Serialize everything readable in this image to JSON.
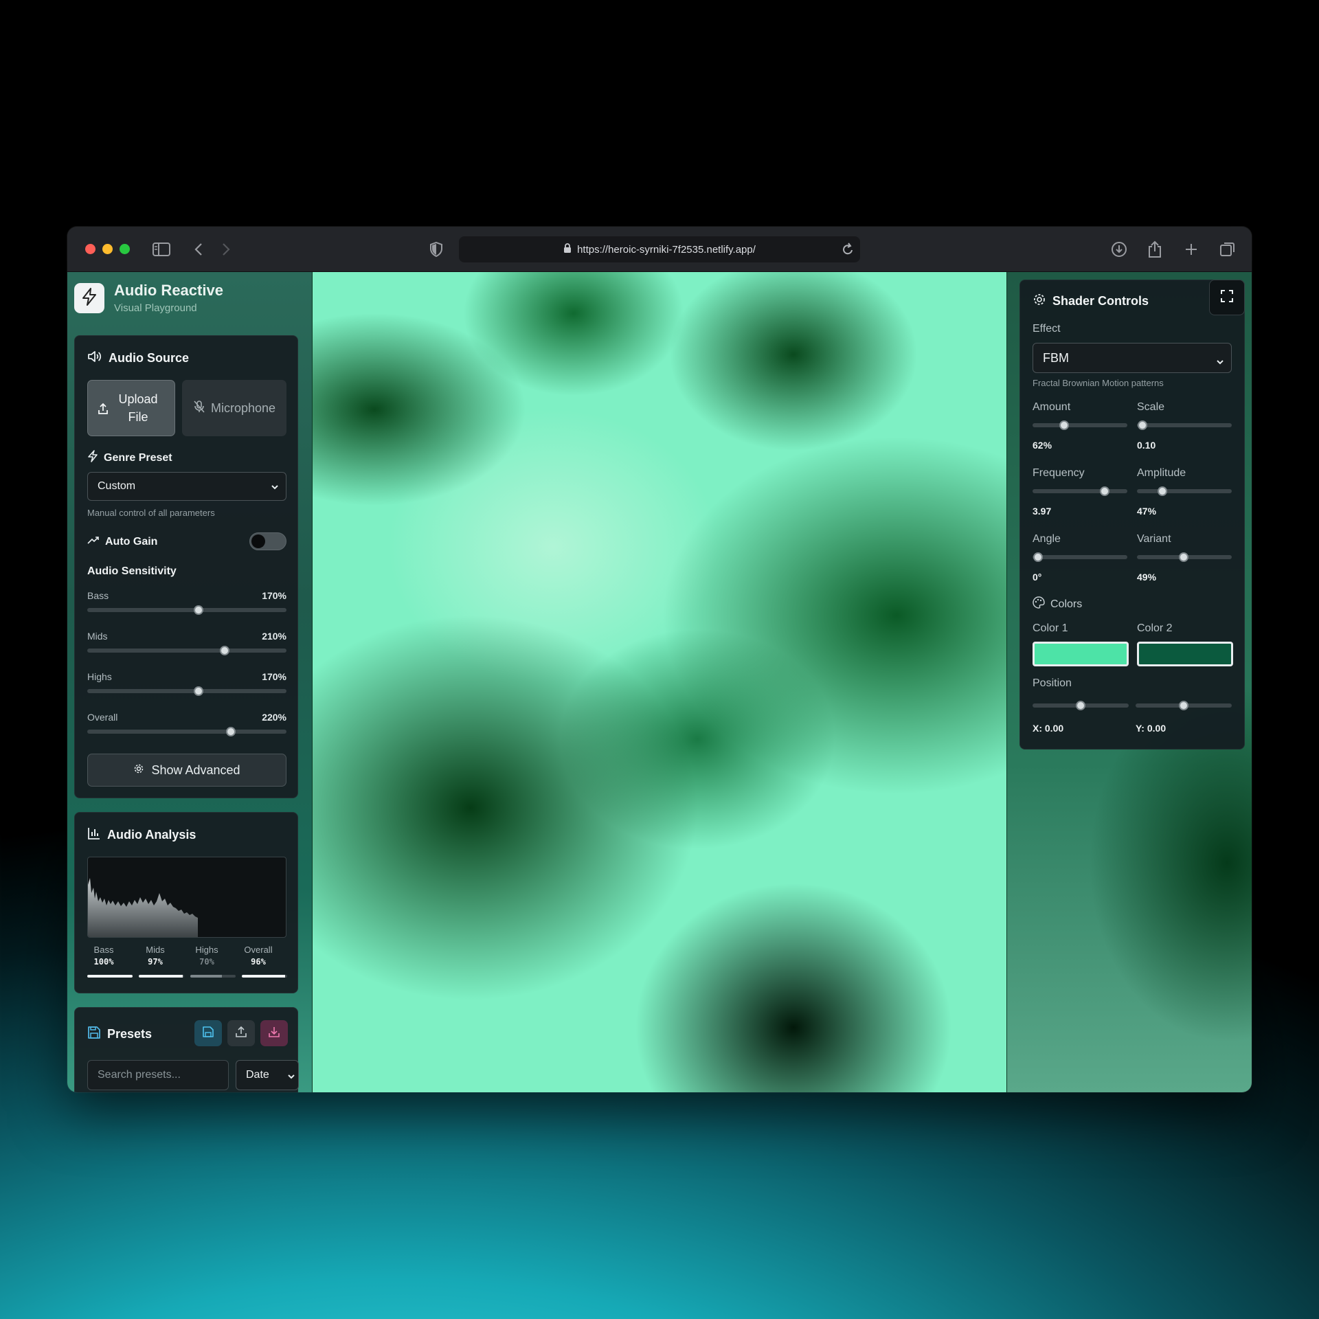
{
  "browser": {
    "url": "https://heroic-syrniki-7f2535.netlify.app/"
  },
  "app": {
    "title": "Audio Reactive",
    "subtitle": "Visual Playground"
  },
  "audio_source": {
    "title": "Audio Source",
    "upload_label": "Upload File",
    "microphone_label": "Microphone",
    "genre_title": "Genre Preset",
    "genre_value": "Custom",
    "genre_hint": "Manual control of all parameters",
    "auto_gain_label": "Auto Gain",
    "auto_gain_on": false,
    "sensitivity_title": "Audio Sensitivity",
    "sliders": [
      {
        "label": "Bass",
        "value": "170%",
        "fraction": 0.56
      },
      {
        "label": "Mids",
        "value": "210%",
        "fraction": 0.69
      },
      {
        "label": "Highs",
        "value": "170%",
        "fraction": 0.56
      },
      {
        "label": "Overall",
        "value": "220%",
        "fraction": 0.72
      }
    ],
    "show_advanced_label": "Show Advanced"
  },
  "audio_analysis": {
    "title": "Audio Analysis",
    "meters": [
      {
        "label": "Bass",
        "value": "100%",
        "fraction": 1.0
      },
      {
        "label": "Mids",
        "value": "97%",
        "fraction": 0.97
      },
      {
        "label": "Highs",
        "value": "70%",
        "fraction": 0.7
      },
      {
        "label": "Overall",
        "value": "96%",
        "fraction": 0.96
      }
    ]
  },
  "presets": {
    "title": "Presets",
    "search_placeholder": "Search presets...",
    "sort_value": "Date"
  },
  "shader_controls": {
    "title": "Shader Controls",
    "effect_label": "Effect",
    "effect_value": "FBM",
    "effect_hint": "Fractal Brownian Motion patterns",
    "params": [
      {
        "label": "Amount",
        "value": "62%",
        "fraction": 0.33
      },
      {
        "label": "Scale",
        "value": "0.10",
        "fraction": 0.06
      },
      {
        "label": "Frequency",
        "value": "3.97",
        "fraction": 0.76
      },
      {
        "label": "Amplitude",
        "value": "47%",
        "fraction": 0.27
      },
      {
        "label": "Angle",
        "value": "0°",
        "fraction": 0.06
      },
      {
        "label": "Variant",
        "value": "49%",
        "fraction": 0.49
      }
    ],
    "colors_title": "Colors",
    "color1_label": "Color 1",
    "color1": "#4de3a7",
    "color2_label": "Color 2",
    "color2": "#0b5a3e",
    "position_label": "Position",
    "position_x": {
      "value": "X: 0.00",
      "fraction": 0.5
    },
    "position_y": {
      "value": "Y: 0.00",
      "fraction": 0.5
    }
  },
  "colors": {
    "accent": "#4de3a7",
    "preset_save_bg": "#1e4a5a",
    "preset_download_bg": "#5a2a44"
  }
}
